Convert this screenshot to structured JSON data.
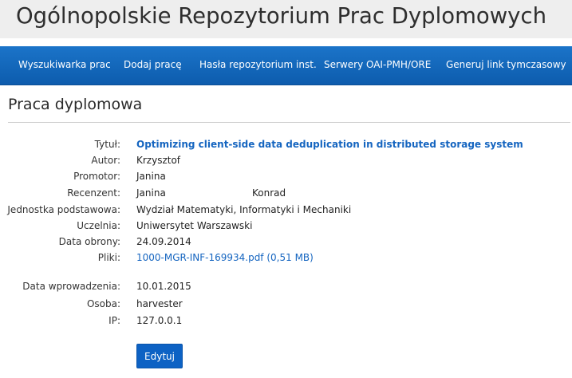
{
  "header": {
    "title": "Ogólnopolskie Repozytorium Prac Dyplomowych"
  },
  "nav": {
    "items": [
      {
        "label": "Wyszukiwarka prac"
      },
      {
        "label": "Dodaj pracę"
      },
      {
        "label": "Hasła repozytorium inst."
      },
      {
        "label": "Serwery OAI-PMH/ORE"
      },
      {
        "label": "Generuj link tymczasowy"
      }
    ]
  },
  "page": {
    "heading": "Praca dyplomowa"
  },
  "thesis": {
    "title_label": "Tytuł:",
    "title_value": "Optimizing client-side data deduplication in distributed storage system",
    "author_label": "Autor:",
    "author_value": "Krzysztof",
    "supervisor_label": "Promotor:",
    "supervisor_value": "Janina",
    "reviewer_label": "Recenzent:",
    "reviewer_value_1": "Janina",
    "reviewer_value_2": "Konrad",
    "unit_label": "Jednostka podstawowa:",
    "unit_value": "Wydział Matematyki, Informatyki i Mechaniki",
    "university_label": "Uczelnia:",
    "university_value": "Uniwersytet Warszawski",
    "defense_label": "Data obrony:",
    "defense_value": "24.09.2014",
    "files_label": "Pliki:",
    "file_link": "1000-MGR-INF-169934.pdf (0,51 MB)",
    "entry_date_label": "Data wprowadzenia:",
    "entry_date_value": "10.01.2015",
    "person_label": "Osoba:",
    "person_value": "harvester",
    "ip_label": "IP:",
    "ip_value": "127.0.0.1"
  },
  "actions": {
    "edit_label": "Edytuj"
  },
  "colors": {
    "navbar": "#1565c0",
    "link": "#1565c0",
    "header_bg": "#eeeeee"
  }
}
